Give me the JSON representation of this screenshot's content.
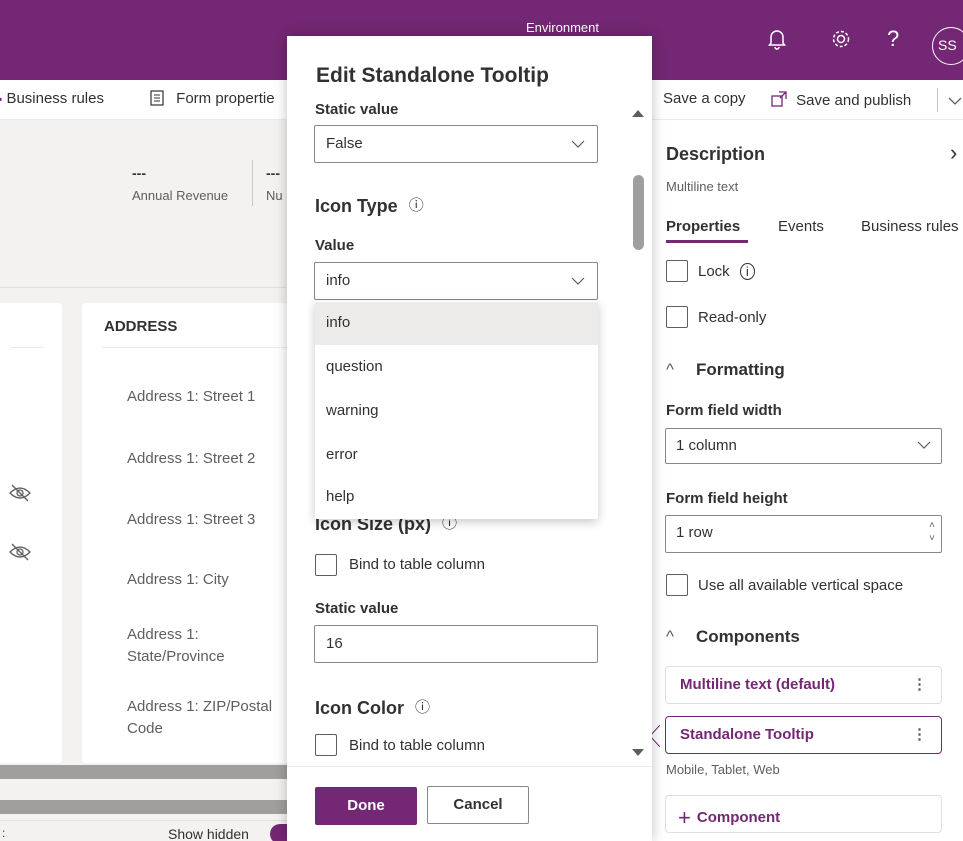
{
  "header": {
    "environment_label": "Environment",
    "avatar_initials": "SS",
    "icons": [
      "bell-icon",
      "gear-icon",
      "help-icon"
    ],
    "brand_color": "#742774"
  },
  "command_bar": {
    "business_rules": "Business rules",
    "form_properties": "Form propertie",
    "save_copy": "Save a copy",
    "save_publish": "Save and publish"
  },
  "form_header": {
    "field1_value": "---",
    "field1_label": "Annual Revenue",
    "field2_value": "---",
    "field2_label": "Nu"
  },
  "address_section": {
    "title": "ADDRESS",
    "fields": [
      "Address 1: Street 1",
      "Address 1: Street 2",
      "Address 1: Street 3",
      "Address 1: City",
      "Address 1: State/Province",
      "Address 1: ZIP/Postal Code"
    ]
  },
  "bottom_bar": {
    "colon": ":",
    "show_hidden": "Show hidden"
  },
  "dialog": {
    "title": "Edit Standalone Tooltip",
    "static_value_label": "Static value",
    "static_value": "False",
    "icon_type_label": "Icon Type",
    "value_label": "Value",
    "icon_type_value": "info",
    "icon_type_options": [
      "info",
      "question",
      "warning",
      "error",
      "help"
    ],
    "icon_size_label": "Icon Size (px)",
    "bind_label": "Bind to table column",
    "size_static_label": "Static value",
    "size_value": "16",
    "icon_color_label": "Icon Color",
    "color_bind_label": "Bind to table column",
    "done": "Done",
    "cancel": "Cancel"
  },
  "properties_panel": {
    "title": "Description",
    "subtitle": "Multiline text",
    "tabs": [
      "Properties",
      "Events",
      "Business rules"
    ],
    "lock_label": "Lock",
    "readonly_label": "Read-only",
    "formatting_label": "Formatting",
    "width_label": "Form field width",
    "width_value": "1 column",
    "height_label": "Form field height",
    "height_value": "1 row",
    "vertical_space_label": "Use all available vertical space",
    "components_label": "Components",
    "components": [
      {
        "name": "Multiline text (default)"
      },
      {
        "name": "Standalone Tooltip"
      }
    ],
    "component_sub": "Mobile, Tablet, Web",
    "add_component": "Component"
  }
}
